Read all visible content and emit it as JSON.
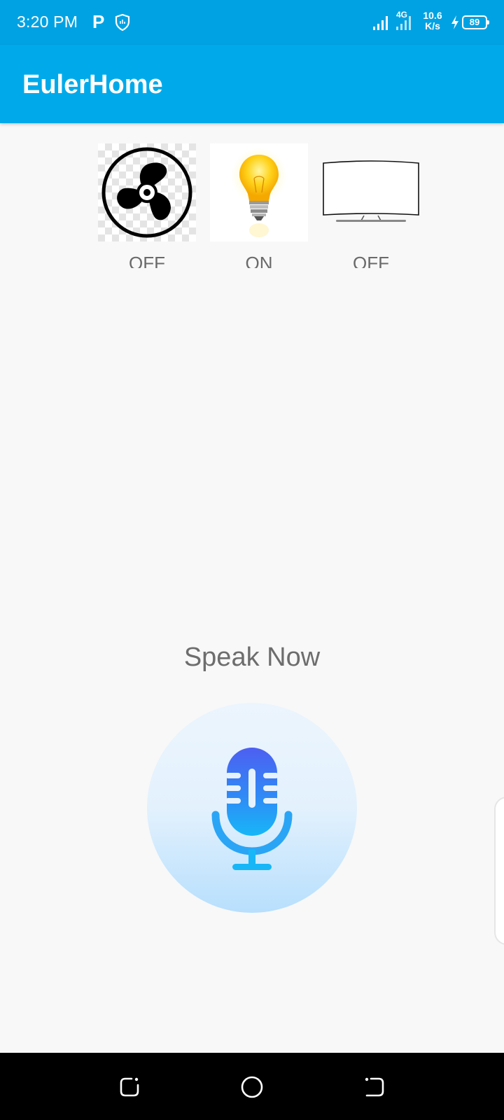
{
  "status_bar": {
    "time": "3:20 PM",
    "network_type": "4G",
    "net_speed_value": "10.6",
    "net_speed_unit": "K/s",
    "battery": "89"
  },
  "app_bar": {
    "title": "EulerHome"
  },
  "devices": [
    {
      "name": "fan",
      "icon": "fan-icon",
      "state": "OFF"
    },
    {
      "name": "bulb",
      "icon": "light-bulb-icon",
      "state": "ON"
    },
    {
      "name": "tv",
      "icon": "tv-icon",
      "state": "OFF"
    }
  ],
  "voice": {
    "prompt": "Speak Now",
    "icon": "microphone-icon"
  },
  "nav_bar": {
    "buttons": [
      "recent-apps",
      "home",
      "back"
    ]
  },
  "colors": {
    "status_bar": "#00a2e3",
    "app_bar": "#00aaea",
    "background": "#f8f8f8",
    "mic_gradient_top": "#4d5ff2",
    "mic_gradient_bottom": "#17b7f7"
  }
}
